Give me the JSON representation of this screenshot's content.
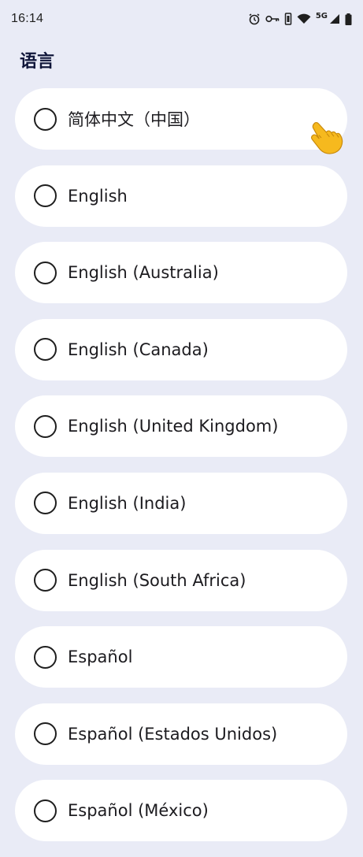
{
  "status_bar": {
    "time": "16:14",
    "network": "5G",
    "icons": [
      "alarm-icon",
      "key-icon",
      "vibrate-icon",
      "wifi-icon",
      "signal-icon",
      "battery-icon"
    ]
  },
  "page": {
    "title": "语言"
  },
  "languages": [
    {
      "label": "简体中文（中国）",
      "selected": false
    },
    {
      "label": "English",
      "selected": false
    },
    {
      "label": "English (Australia)",
      "selected": false
    },
    {
      "label": "English (Canada)",
      "selected": false
    },
    {
      "label": "English (United Kingdom)",
      "selected": false
    },
    {
      "label": "English (India)",
      "selected": false
    },
    {
      "label": "English (South Africa)",
      "selected": false
    },
    {
      "label": "Español",
      "selected": false
    },
    {
      "label": "Español (Estados Unidos)",
      "selected": false
    },
    {
      "label": "Español (México)",
      "selected": false
    }
  ],
  "colors": {
    "background": "#e9ebf6",
    "card": "#ffffff",
    "title": "#10163a",
    "pointer_hand": "#f6b91e"
  }
}
